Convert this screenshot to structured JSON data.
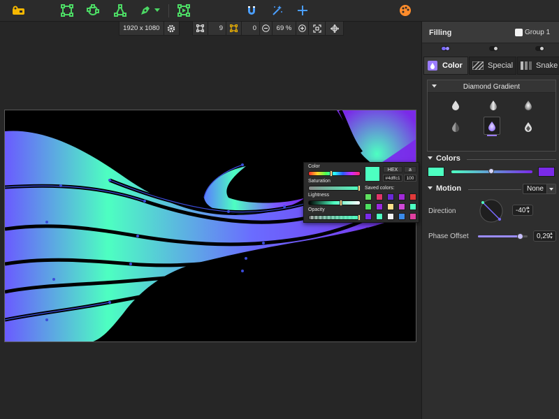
{
  "toolbar": {
    "icons": [
      "logo-icon",
      "rectangle-select-icon",
      "lasso-select-icon",
      "triangle-select-icon",
      "pen-tool-icon",
      "frame-play-icon",
      "magnet-icon",
      "magic-wand-icon",
      "crosshair-icon",
      "palette-icon"
    ],
    "accent_green": "#4cd964",
    "accent_blue": "#4a9eff",
    "accent_orange": "#ff8c2b"
  },
  "subbar": {
    "canvas_size": "1920 x 1080",
    "rect_count": "9",
    "anchor_count": "0",
    "zoom": "69 %"
  },
  "color_popup": {
    "color_label": "Color",
    "saturation_label": "Saturation",
    "lightness_label": "Lightness",
    "opacity_label": "Opacity",
    "hex_label": "HEX",
    "alpha_label": "a",
    "hex_value": "#4dffc1",
    "alpha_value": "100",
    "saved_colors_label": "Saved colors:",
    "current_color": "#4dffc1",
    "saved_colors": [
      "#5fe05f",
      "#e0356a",
      "#6a2ad8",
      "#a12ad8",
      "#e03a3a",
      "#4de060",
      "#9a2ae0",
      "#ffe08a",
      "#d04ad8",
      "#4dffc1",
      "#7a2ae8",
      "#4dffc1",
      "#f2f2f2",
      "#3a8ae8",
      "#e040a0"
    ]
  },
  "panel": {
    "title": "Filling",
    "group_label": "Group 1",
    "tabs": [
      {
        "label": "Color",
        "icon": "droplet-icon"
      },
      {
        "label": "Special",
        "icon": "stripes-icon"
      },
      {
        "label": "Snake",
        "icon": "bars-icon"
      }
    ],
    "gradient_type": "Diamond Gradient",
    "colors_label": "Colors",
    "color_start": "#4dffc1",
    "color_end": "#7a2ae8",
    "motion_label": "Motion",
    "motion_value": "None",
    "direction_label": "Direction",
    "direction_value": "-40°",
    "phase_label": "Phase Offset",
    "phase_value": "0,29",
    "phase_fraction": 0.29
  }
}
